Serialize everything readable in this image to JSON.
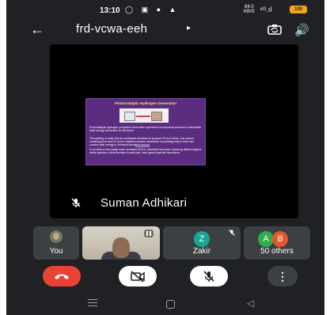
{
  "status_bar": {
    "time": "13:10",
    "left_icons": "◯ ▣ ● ▲",
    "network_speed_value": "84.0",
    "network_speed_unit": "KB/S",
    "signal": "⁴ᴳ.ıl",
    "battery": "100"
  },
  "header": {
    "meeting_code": "frd-vcwa-eeh",
    "caret": "▸"
  },
  "main_tile": {
    "participant_name": "Suman Adhikari",
    "slide": {
      "title": "Photocatalytic Hydrogen Generation",
      "paragraph_1": "Photocatalytic hydrogen production from water represents an important process in sustainable solar energy conversion for the future.",
      "paragraph_2": "The splitting of water into its constituent elements to produce H2 as a clean, non-carbon containing fuel and O2 as the oxidation product represents a promising way to store and convert solar energy in chemical bonds.",
      "paragraph_3": "In an effort to find stable earth abundant WOCs, chemists have been exploring different ligand-metal systems, cobalt dioxides in particular, have gained special importance."
    }
  },
  "thumbnails": {
    "you": {
      "label": "You"
    },
    "zakir": {
      "label": "Zakir",
      "initial": "Z",
      "avatar_color": "#1aa693"
    },
    "others": {
      "label": "50 others",
      "initial_a": "A",
      "initial_b": "B",
      "color_a": "#2eae4e",
      "color_b": "#e8562b"
    }
  },
  "controls": {
    "leave_color": "#ea4335",
    "more_label": "⋮"
  },
  "nav": {
    "back_glyph": "◁"
  }
}
